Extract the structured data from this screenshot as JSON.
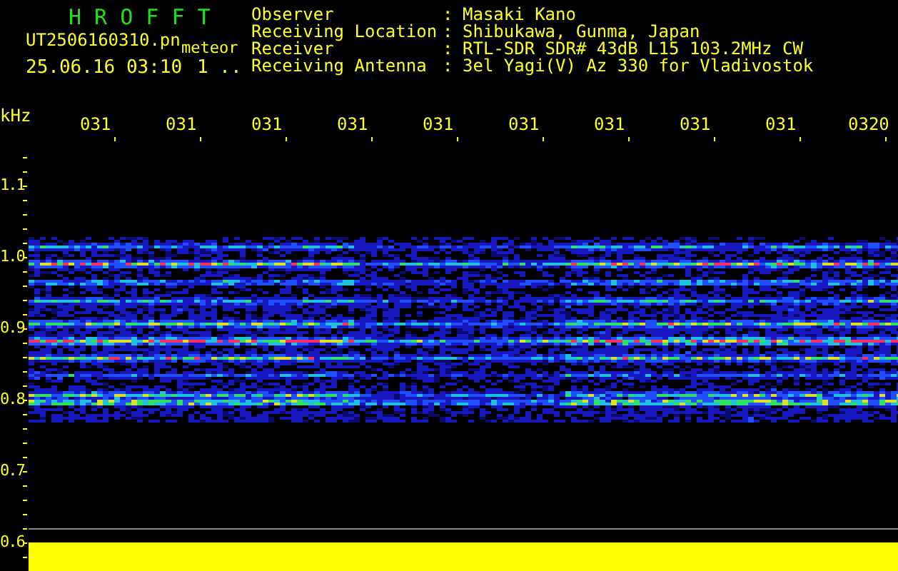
{
  "title": "H R O F F T",
  "file_name": "UT2506160310.pn",
  "mode": "meteor",
  "timestamp": "25.06.16 03:10",
  "counter": "1 ..",
  "info": [
    {
      "label": "Observer",
      "value": "Masaki Kano"
    },
    {
      "label": "Receiving Location",
      "value": "Shibukawa, Gunma, Japan"
    },
    {
      "label": "Receiver",
      "value": "RTL-SDR SDR# 43dB L15 103.2MHz CW"
    },
    {
      "label": "Receiving Antenna",
      "value": "3el Yagi(V) Az 330 for Vladivostok"
    }
  ],
  "separator": ":",
  "y_unit": "kHz",
  "time_labels": [
    "031",
    "031",
    "031",
    "031",
    "031",
    "031",
    "031",
    "031",
    "031",
    "0320"
  ],
  "y_labels": [
    "1.1",
    "1.0",
    "0.9",
    "0.8",
    "0.7",
    "0.6"
  ]
}
